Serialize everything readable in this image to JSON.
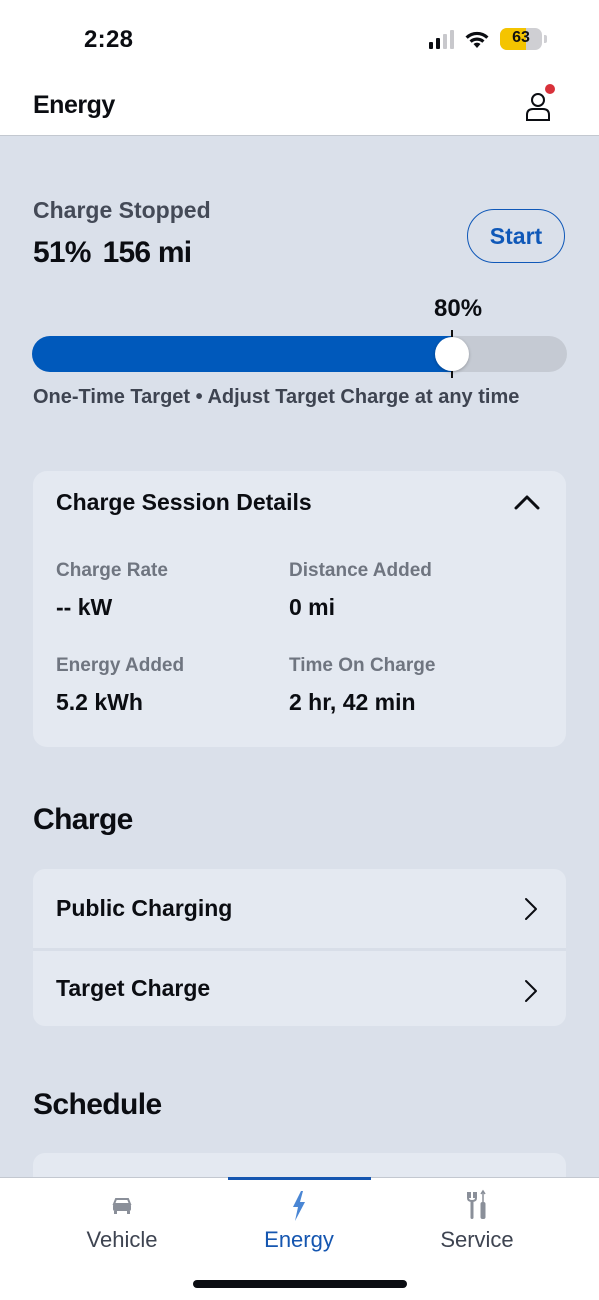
{
  "status_bar": {
    "time": "2:28",
    "signal_bars_active": 2,
    "signal_bars_total": 4,
    "battery_percent": 63,
    "battery_label": "63",
    "battery_color": "#f4c400"
  },
  "header": {
    "title": "Energy",
    "profile_icon": "person-icon",
    "has_notification": true,
    "notification_color": "#d8313a"
  },
  "charge": {
    "status": "Charge Stopped",
    "battery_level": "51%",
    "range": "156 mi",
    "start_button_label": "Start",
    "target_label": "80%",
    "target_percent": 80,
    "target_note": "One-Time Target • Adjust Target Charge at any time",
    "accent_color": "#0059bb"
  },
  "session_details": {
    "title": "Charge Session Details",
    "expanded": true,
    "items": [
      {
        "label": "Charge Rate",
        "value": "-- kW"
      },
      {
        "label": "Distance Added",
        "value": "0 mi"
      },
      {
        "label": "Energy Added",
        "value": "5.2 kWh"
      },
      {
        "label": "Time On Charge",
        "value": "2 hr, 42 min"
      }
    ]
  },
  "charge_section": {
    "heading": "Charge",
    "items": [
      {
        "label": "Public Charging"
      },
      {
        "label": "Target Charge"
      }
    ]
  },
  "schedule_section": {
    "heading": "Schedule"
  },
  "tab_bar": {
    "active": "Energy",
    "tabs": [
      {
        "label": "Vehicle",
        "icon": "car-icon"
      },
      {
        "label": "Energy",
        "icon": "lightning-icon"
      },
      {
        "label": "Service",
        "icon": "tools-icon"
      }
    ]
  }
}
